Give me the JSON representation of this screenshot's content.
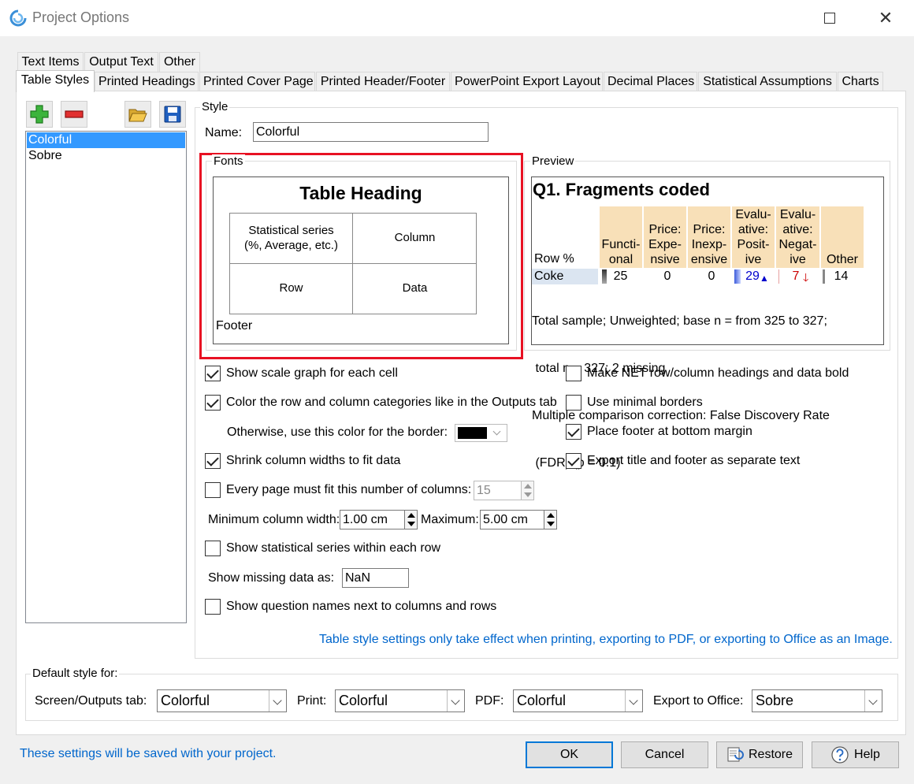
{
  "window": {
    "title": "Project Options"
  },
  "tabs_row1": [
    "Text Items",
    "Output Text",
    "Other"
  ],
  "tabs_row2": [
    "Table Styles",
    "Printed Headings",
    "Printed Cover Page",
    "Printed Header/Footer",
    "PowerPoint Export Layout",
    "Decimal Places",
    "Statistical Assumptions",
    "Charts"
  ],
  "styles_list": [
    "Colorful",
    "Sobre"
  ],
  "style_group": {
    "label": "Style",
    "name_label": "Name:",
    "name_value": "Colorful"
  },
  "fonts": {
    "label": "Fonts",
    "table_heading": "Table Heading",
    "statistical_series": "Statistical series",
    "statistical_series_sub": "(%, Average, etc.)",
    "column": "Column",
    "row": "Row",
    "data": "Data",
    "footer": "Footer"
  },
  "preview": {
    "label": "Preview",
    "title": "Q1.  Fragments coded",
    "row_header": "Row %",
    "columns": [
      [
        "Functi-",
        "onal"
      ],
      [
        "Price:",
        "Expe-",
        "nsive"
      ],
      [
        "Price:",
        "Inexp-",
        "ensive"
      ],
      [
        "Evalu-",
        "ative:",
        "Posit-",
        "ive"
      ],
      [
        "Evalu-",
        "ative:",
        "Negat-",
        "ive"
      ],
      [
        "Other"
      ]
    ],
    "row_label": "Coke",
    "values": [
      "25",
      "0",
      "0",
      "29",
      "7",
      "14"
    ],
    "footer_lines": [
      "Total sample; Unweighted; base n = from 325 to 327;",
      " total n = 327; 2 missing",
      "Multiple comparison correction: False Discovery Rate",
      " (FDR) (p = 0.1)"
    ],
    "colors": {
      "header": "#f8e0b8",
      "row": "#dbe5f1",
      "positive": "#0000cc",
      "negative": "#cc0000"
    }
  },
  "options": {
    "show_scale_graph": {
      "label": "Show scale graph for each cell",
      "checked": true
    },
    "color_categories": {
      "label": "Color the row and column categories like in the Outputs tab",
      "checked": true
    },
    "border_color_label": "Otherwise, use this color for the border:",
    "border_color": "#000000",
    "shrink_columns": {
      "label": "Shrink column widths to fit data",
      "checked": true
    },
    "fit_columns": {
      "label": "Every page must fit this number of columns:",
      "checked": false,
      "value": "15"
    },
    "min_width_label": "Minimum column width:",
    "min_width_value": "1.00 cm",
    "max_label": "Maximum:",
    "max_value": "5.00 cm",
    "stat_series_within_row": {
      "label": "Show statistical series within each row",
      "checked": false
    },
    "missing_label": "Show missing data as:",
    "missing_value": "NaN",
    "question_names": {
      "label": "Show question names next to columns and rows",
      "checked": false
    },
    "net_bold": {
      "label": "Make NET row/column headings and data bold",
      "checked": false
    },
    "minimal_borders": {
      "label": "Use minimal borders",
      "checked": false
    },
    "footer_bottom": {
      "label": "Place footer at bottom margin",
      "checked": true
    },
    "export_title_footer": {
      "label": "Export title and footer as separate text",
      "checked": true
    }
  },
  "note_text": "Table style settings only take effect when printing, exporting to PDF, or exporting to Office as an Image.",
  "default_style": {
    "label": "Default style for:",
    "screen_label": "Screen/Outputs tab:",
    "screen_value": "Colorful",
    "print_label": "Print:",
    "print_value": "Colorful",
    "pdf_label": "PDF:",
    "pdf_value": "Colorful",
    "office_label": "Export to Office:",
    "office_value": "Sobre"
  },
  "footer_note": "These settings will be saved with your project.",
  "buttons": {
    "ok": "OK",
    "cancel": "Cancel",
    "restore": "Restore",
    "help": "Help"
  },
  "accent_color": "#0066cc",
  "highlight_color": "#e81123"
}
